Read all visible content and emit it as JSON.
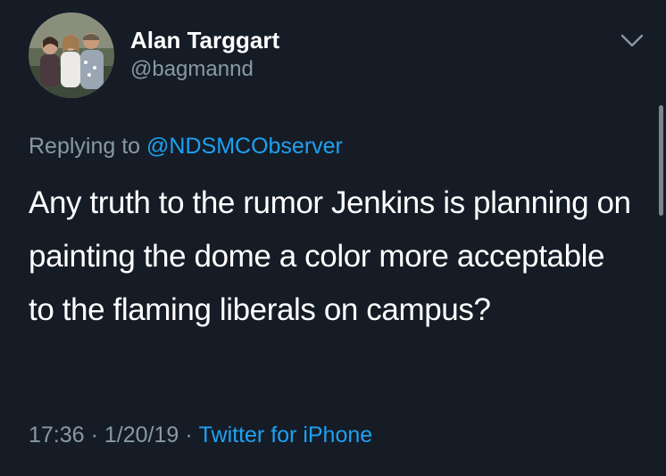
{
  "tweet": {
    "display_name": "Alan Targgart",
    "handle": "@bagmannd",
    "replying_to_prefix": "Replying to",
    "replying_to_handle": "@NDSMCObserver",
    "text": "Any truth to the rumor Jenkins is planning on painting the dome a color more acceptable to the flaming liberals on campus?",
    "time": "17:36",
    "date": "1/20/19",
    "separator": "·",
    "source": "Twitter for iPhone"
  },
  "icons": {
    "caret": "chevron-down-icon",
    "avatar": "profile-photo"
  },
  "colors": {
    "background": "#151c26",
    "primary_text": "#ffffff",
    "secondary_text": "#8899a6",
    "link": "#1da1f2"
  }
}
